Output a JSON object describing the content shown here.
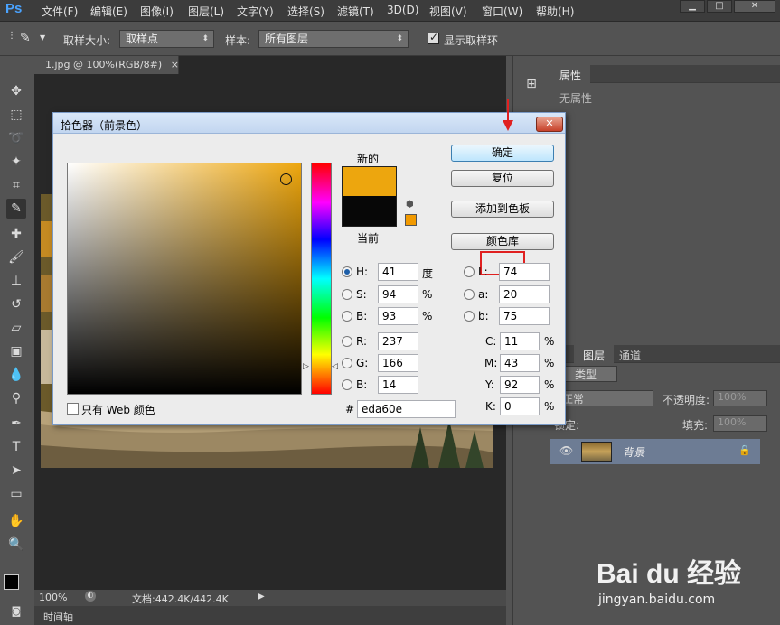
{
  "app": {
    "logo": "Ps",
    "menu": [
      "文件(F)",
      "编辑(E)",
      "图像(I)",
      "图层(L)",
      "文字(Y)",
      "选择(S)",
      "滤镜(T)",
      "3D(D)",
      "视图(V)",
      "窗口(W)",
      "帮助(H)"
    ],
    "window_buttons": [
      "▁",
      "□",
      "✕"
    ]
  },
  "options_bar": {
    "sample_size_label": "取样大小:",
    "sample_size_value": "取样点",
    "sample_label": "样本:",
    "sample_value": "所有图层",
    "show_ring_label": "显示取样环",
    "show_ring_checked": true
  },
  "document": {
    "tab_title": "1.jpg @ 100%(RGB/8#)",
    "tab_close": "×",
    "zoom": "100%",
    "doc_info": "文档:442.4K/442.4K",
    "timeline_label": "时间轴"
  },
  "properties_panel": {
    "tab": "属性",
    "empty_text": "无属性"
  },
  "layers_panel": {
    "tabs": [
      "图层",
      "通道"
    ],
    "filter_label": "类型",
    "blend_mode": "正常",
    "opacity_label": "不透明度:",
    "opacity_value": "100%",
    "lock_label": "锁定:",
    "fill_label": "填充:",
    "fill_value": "100%",
    "layer_name": "背景"
  },
  "color_picker": {
    "title": "拾色器（前景色）",
    "new_label": "新的",
    "current_label": "当前",
    "new_color": "#eda60e",
    "current_color": "#070707",
    "buttons": {
      "ok": "确定",
      "reset": "复位",
      "add_to_swatches": "添加到色板",
      "color_libraries": "颜色库"
    },
    "web_only_label": "只有 Web 颜色",
    "hsb": [
      {
        "label": "H:",
        "value": "41",
        "unit": "度",
        "selected": true
      },
      {
        "label": "S:",
        "value": "94",
        "unit": "%",
        "selected": false
      },
      {
        "label": "B:",
        "value": "93",
        "unit": "%",
        "selected": false
      }
    ],
    "rgb": [
      {
        "label": "R:",
        "value": "237"
      },
      {
        "label": "G:",
        "value": "166"
      },
      {
        "label": "B:",
        "value": "14"
      }
    ],
    "lab": [
      {
        "label": "L:",
        "value": "74"
      },
      {
        "label": "a:",
        "value": "20"
      },
      {
        "label": "b:",
        "value": "75"
      }
    ],
    "cmyk": [
      {
        "label": "C:",
        "value": "11",
        "unit": "%"
      },
      {
        "label": "M:",
        "value": "43",
        "unit": "%"
      },
      {
        "label": "Y:",
        "value": "92",
        "unit": "%"
      },
      {
        "label": "K:",
        "value": "0",
        "unit": "%"
      }
    ],
    "hex_label": "#",
    "hex_value": "eda60e"
  },
  "watermark": {
    "brand": "Bai du 经验",
    "url": "jingyan.baidu.com"
  }
}
